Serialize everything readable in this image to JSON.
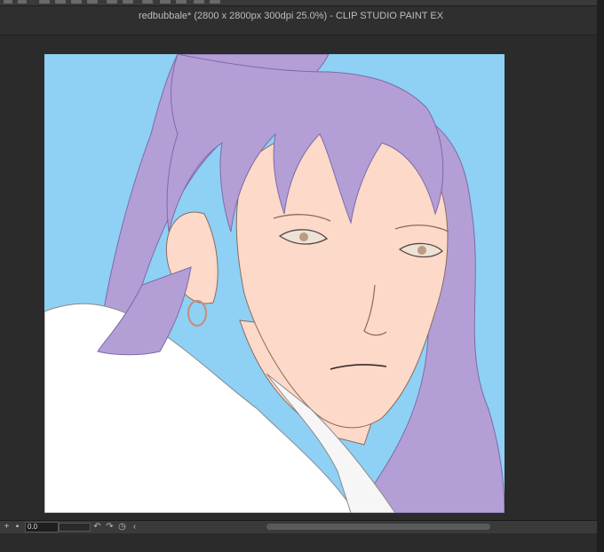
{
  "window": {
    "title": "redbubbale* (2800 x 2800px 300dpi 25.0%)  - CLIP STUDIO PAINT EX"
  },
  "canvas": {
    "background_color": "#8fd0f5",
    "hair_color": "#b39fd6",
    "skin_color": "#fcd9c8",
    "clothing_color": "#ffffff"
  },
  "status_bar": {
    "rotation_value": "0.0",
    "buttons": [
      "plus-icon",
      "square-icon",
      "rotate-left-icon",
      "rotate-right-icon",
      "reset-rotation-icon",
      "flip-icon"
    ]
  }
}
